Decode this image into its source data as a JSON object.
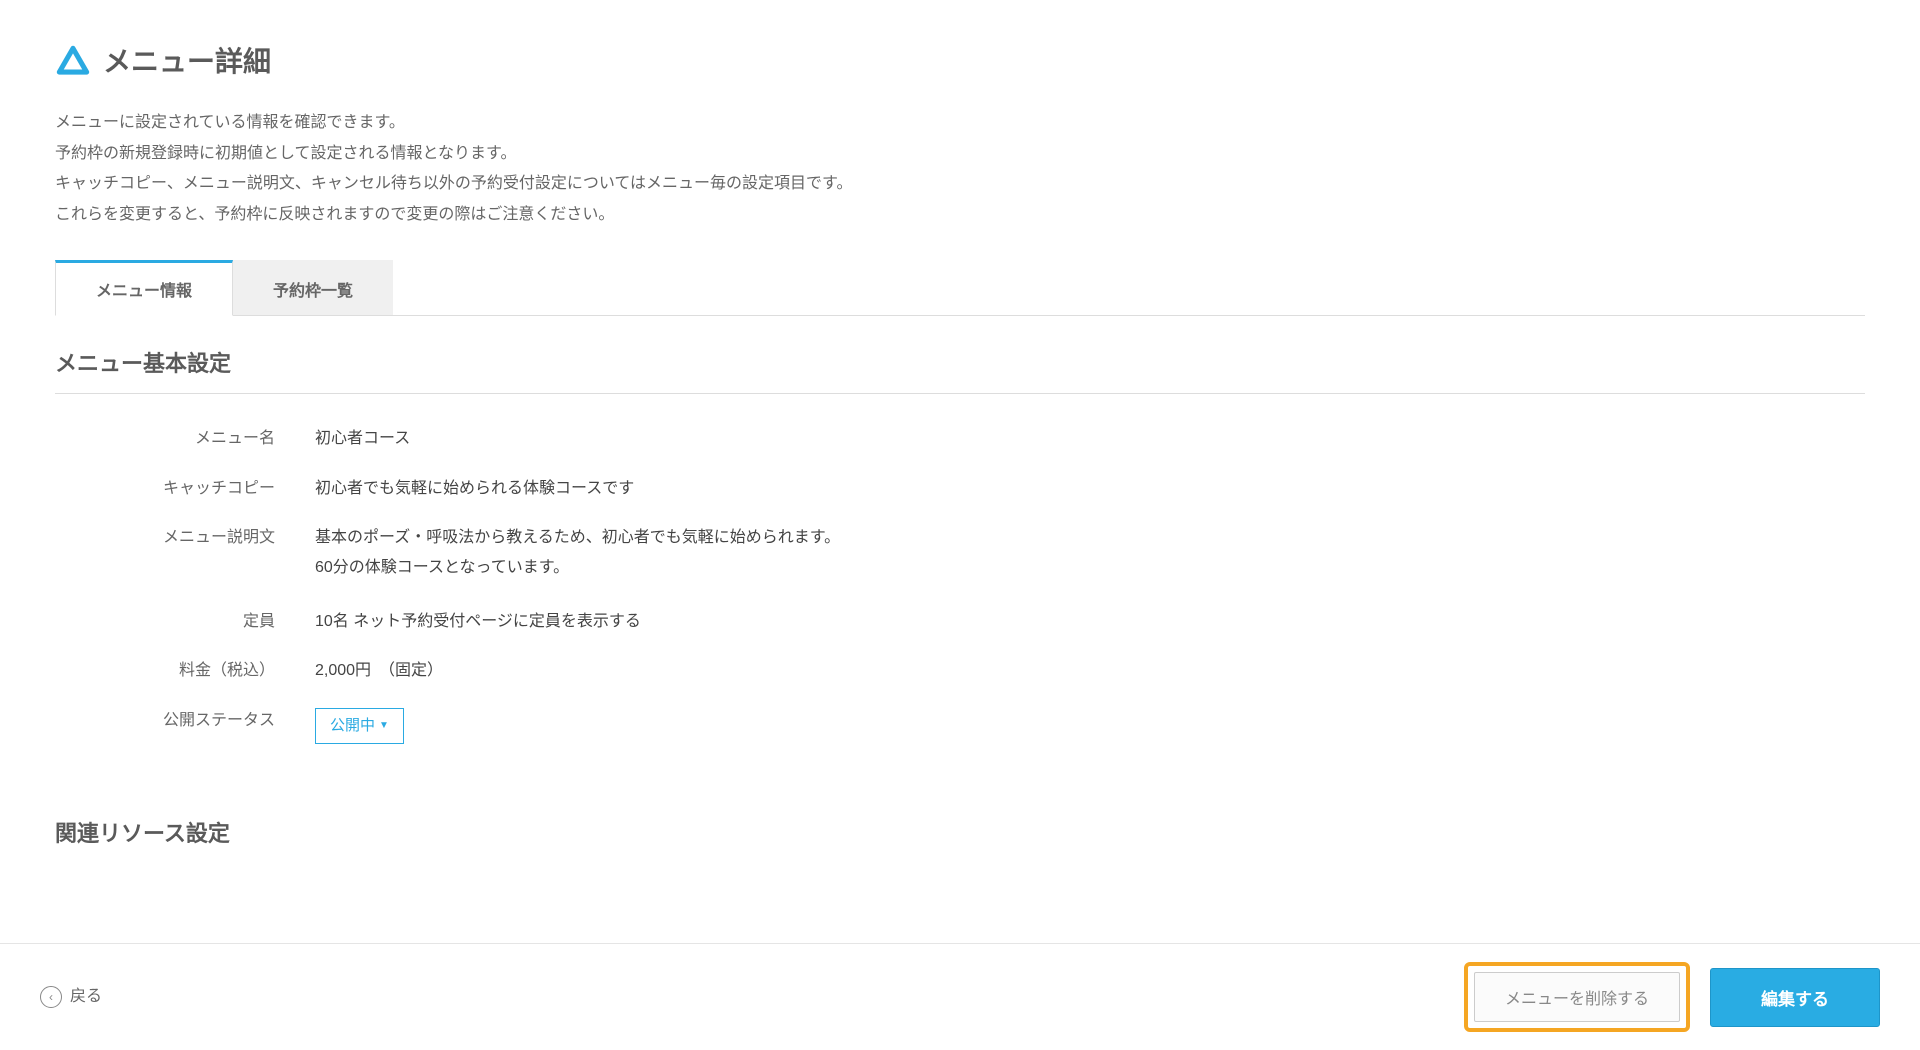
{
  "header": {
    "title": "メニュー詳細"
  },
  "description": {
    "line1": "メニューに設定されている情報を確認できます。",
    "line2": "予約枠の新規登録時に初期値として設定される情報となります。",
    "line3": "キャッチコピー、メニュー説明文、キャンセル待ち以外の予約受付設定についてはメニュー毎の設定項目です。",
    "line4": "これらを変更すると、予約枠に反映されますので変更の際はご注意ください。"
  },
  "tabs": {
    "menu_info": "メニュー情報",
    "slot_list": "予約枠一覧"
  },
  "section_basic": {
    "title": "メニュー基本設定",
    "fields": {
      "menu_name": {
        "label": "メニュー名",
        "value": "初心者コース"
      },
      "catch_copy": {
        "label": "キャッチコピー",
        "value": "初心者でも気軽に始められる体験コースです"
      },
      "description": {
        "label": "メニュー説明文",
        "line1": "基本のポーズ・呼吸法から教えるため、初心者でも気軽に始められます。",
        "line2": "60分の体験コースとなっています。"
      },
      "capacity": {
        "label": "定員",
        "value": "10名 ネット予約受付ページに定員を表示する"
      },
      "price": {
        "label": "料金（税込）",
        "value": "2,000円　（固定）"
      },
      "status": {
        "label": "公開ステータス",
        "value": "公開中"
      }
    }
  },
  "section_resource": {
    "title": "関連リソース設定"
  },
  "footer": {
    "back": "戻る",
    "delete": "メニューを削除する",
    "edit": "編集する"
  }
}
